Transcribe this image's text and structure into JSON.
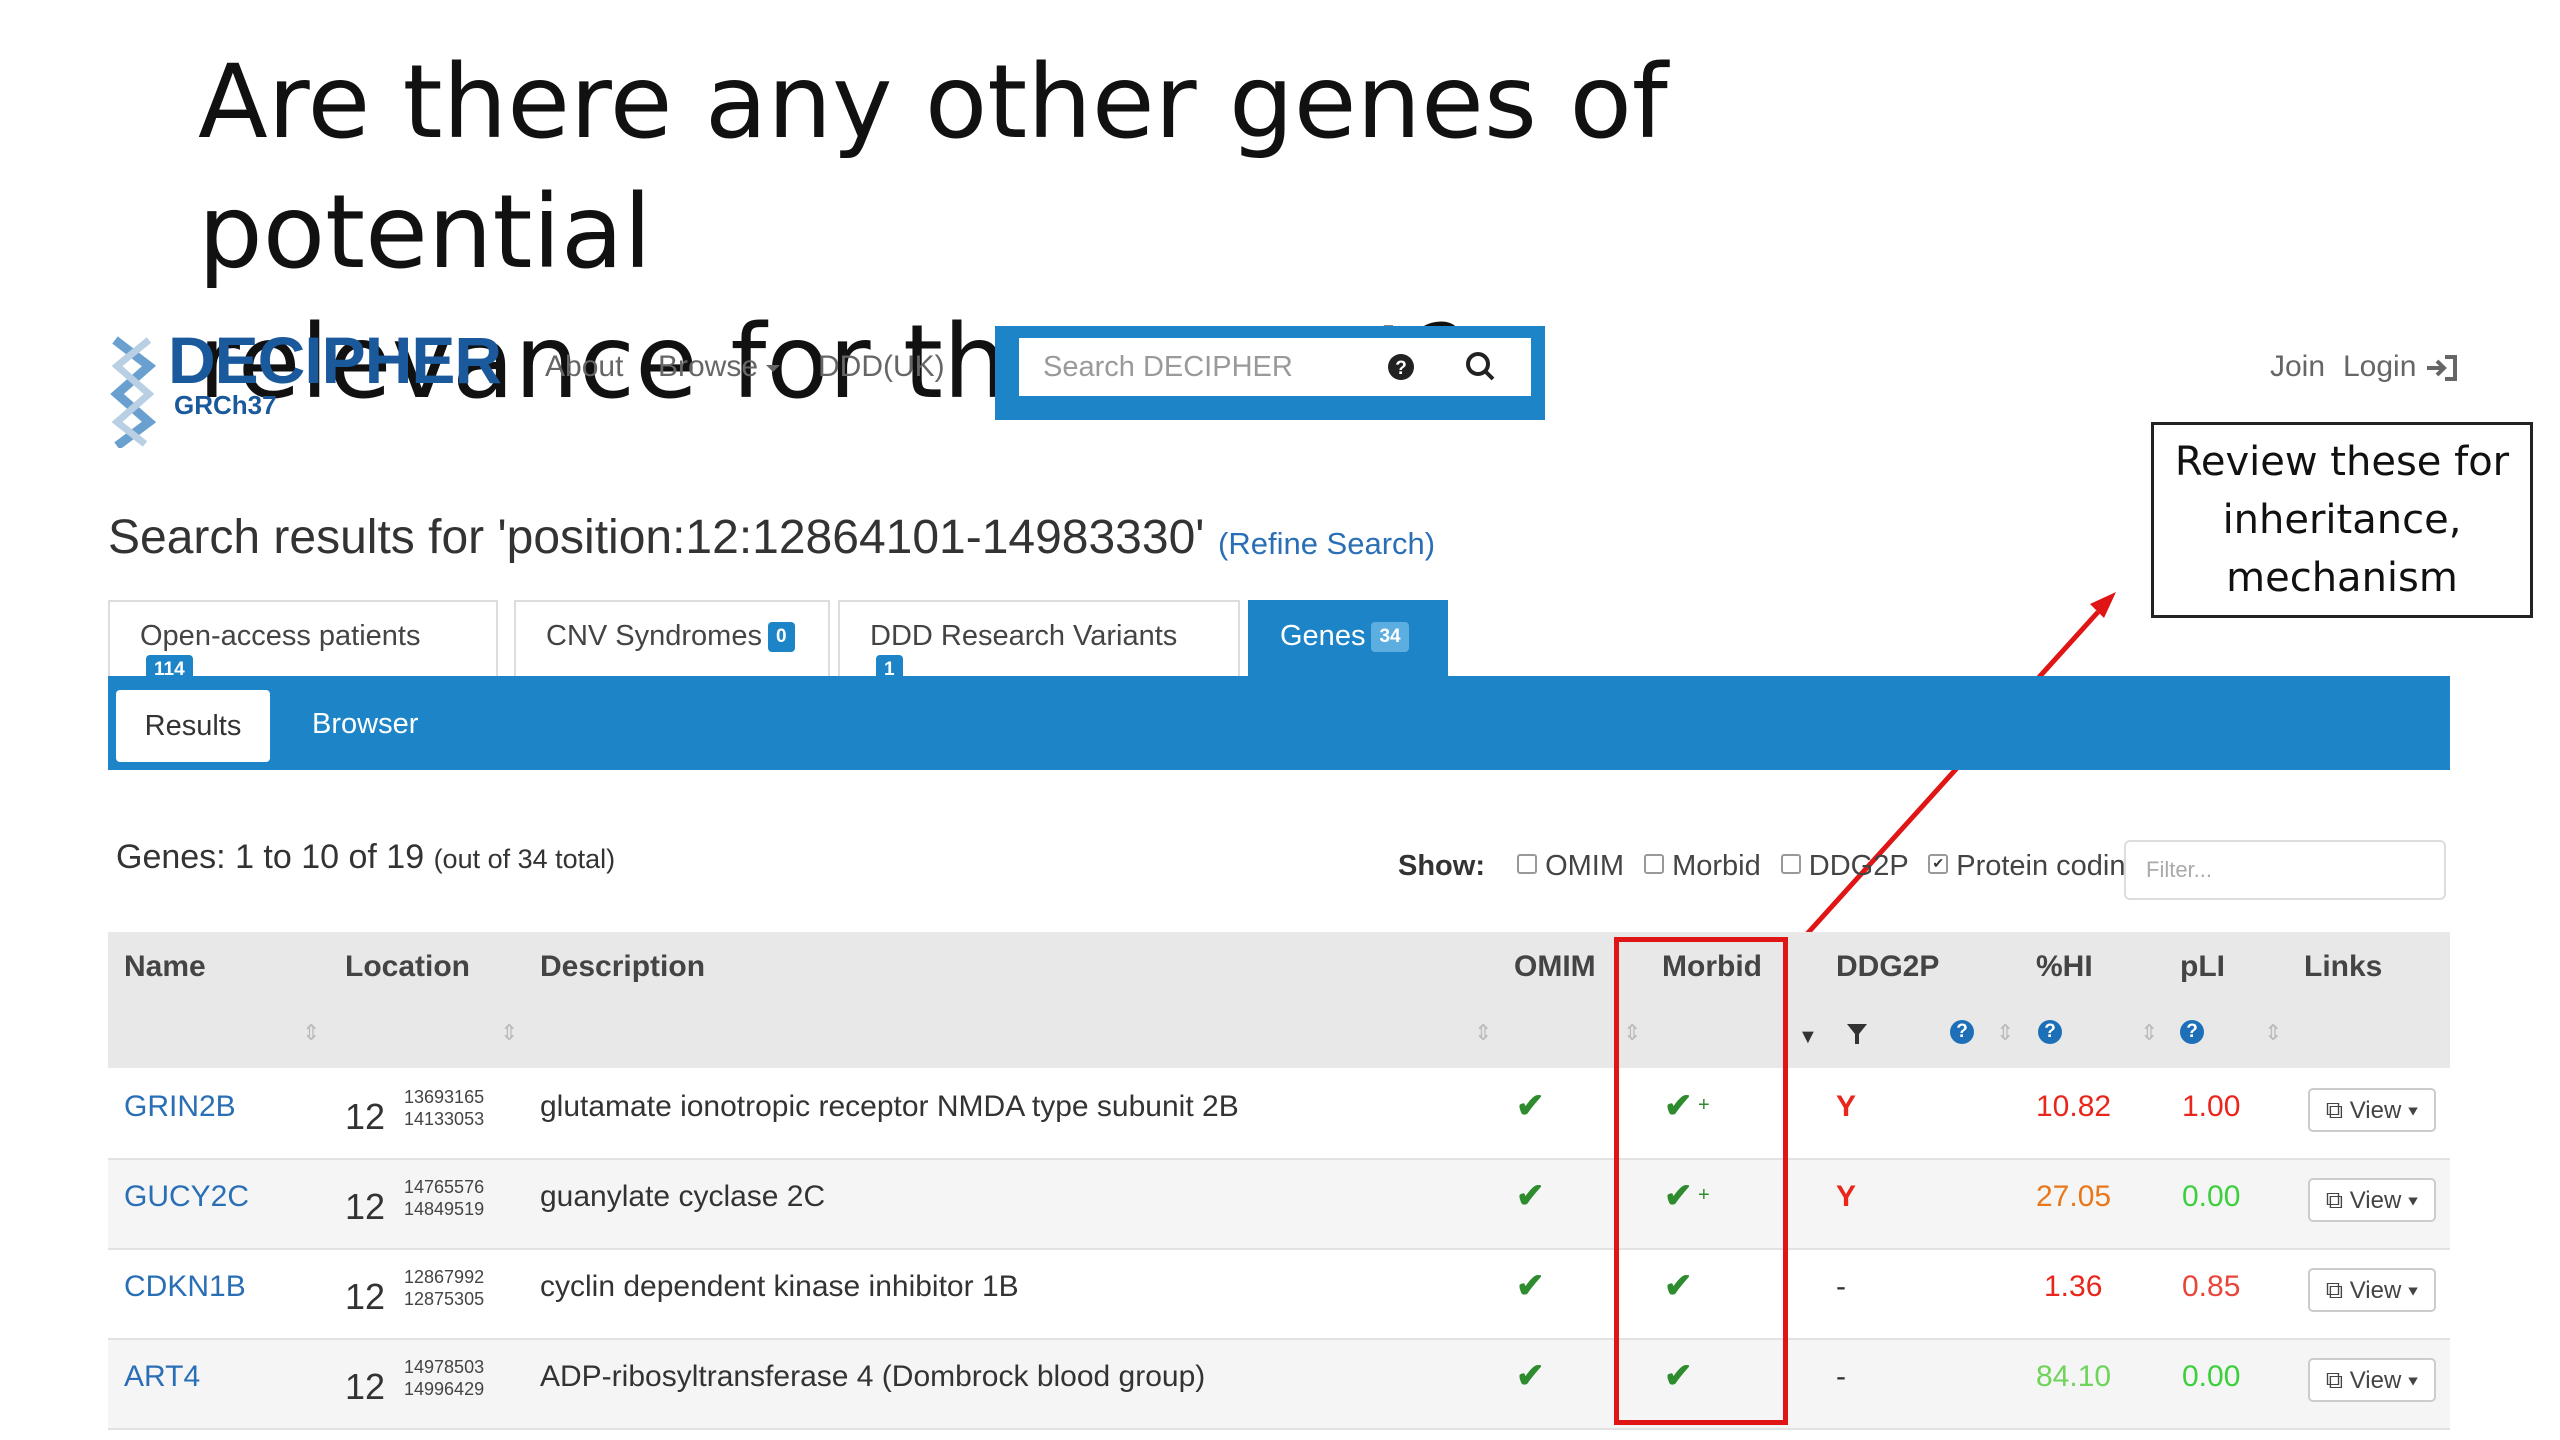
{
  "slide": {
    "title_line1": "Are there any other genes of potential",
    "title_line2": "relevance for the report?"
  },
  "header": {
    "logo_text": "DECIPHER",
    "logo_sub": "GRCh37",
    "nav": {
      "about": "About",
      "browse": "Browse",
      "ddd": "DDD(UK)"
    },
    "search": {
      "placeholder": "Search DECIPHER"
    },
    "join": "Join",
    "login": "Login"
  },
  "callout": {
    "line1": "Review these for",
    "line2": "inheritance,",
    "line3": "mechanism"
  },
  "results": {
    "heading": "Search results for 'position:12:12864101-14983330'",
    "refine": "(Refine Search)",
    "tabs": [
      {
        "label": "Open-access patients",
        "count": "114"
      },
      {
        "label": "CNV Syndromes",
        "count": "0"
      },
      {
        "label": "DDD Research Variants",
        "count": "1"
      },
      {
        "label": "Genes",
        "count": "34"
      }
    ],
    "subtabs": {
      "results": "Results",
      "browser": "Browser"
    },
    "summary_main": "Genes: 1 to 10 of 19",
    "summary_note": "(out of 34 total)",
    "show": {
      "label": "Show:",
      "omim": "OMIM",
      "morbid": "Morbid",
      "ddg2p": "DDG2P",
      "protein_coding": "Protein coding",
      "protein_coding_checked": true
    },
    "filter_placeholder": "Filter..."
  },
  "table": {
    "columns": {
      "name": "Name",
      "location": "Location",
      "description": "Description",
      "omim": "OMIM",
      "morbid": "Morbid",
      "ddg2p": "DDG2P",
      "hi": "%HI",
      "pli": "pLI",
      "links": "Links"
    },
    "view_label": "View",
    "rows": [
      {
        "name": "GRIN2B",
        "chr": "12",
        "start": "13693165",
        "end": "14133053",
        "description": "glutamate ionotropic receptor NMDA type subunit 2B",
        "omim": "✔",
        "morbid": "✔",
        "morbid_plus": "+",
        "ddg2p": "Y",
        "hi": "10.82",
        "pli": "1.00",
        "hi_color": "#e8261b",
        "pli_color": "#e8261b"
      },
      {
        "name": "GUCY2C",
        "chr": "12",
        "start": "14765576",
        "end": "14849519",
        "description": "guanylate cyclase 2C",
        "omim": "✔",
        "morbid": "✔",
        "morbid_plus": "+",
        "ddg2p": "Y",
        "hi": "27.05",
        "pli": "0.00",
        "hi_color": "#e8781b",
        "pli_color": "#3ecf3e"
      },
      {
        "name": "CDKN1B",
        "chr": "12",
        "start": "12867992",
        "end": "12875305",
        "description": "cyclin dependent kinase inhibitor 1B",
        "omim": "✔",
        "morbid": "✔",
        "morbid_plus": "",
        "ddg2p": "-",
        "hi": "1.36",
        "pli": "0.85",
        "hi_color": "#e8261b",
        "pli_color": "#e8463b"
      },
      {
        "name": "ART4",
        "chr": "12",
        "start": "14978503",
        "end": "14996429",
        "description": "ADP-ribosyltransferase 4 (Dombrock blood group)",
        "omim": "✔",
        "morbid": "✔",
        "morbid_plus": "",
        "ddg2p": "-",
        "hi": "84.10",
        "pli": "0.00",
        "hi_color": "#6fd45a",
        "pli_color": "#3ecf3e"
      }
    ]
  },
  "colors": {
    "brand": "#1d85c7",
    "highlight": "#e01515",
    "arrow": "#e01515"
  }
}
